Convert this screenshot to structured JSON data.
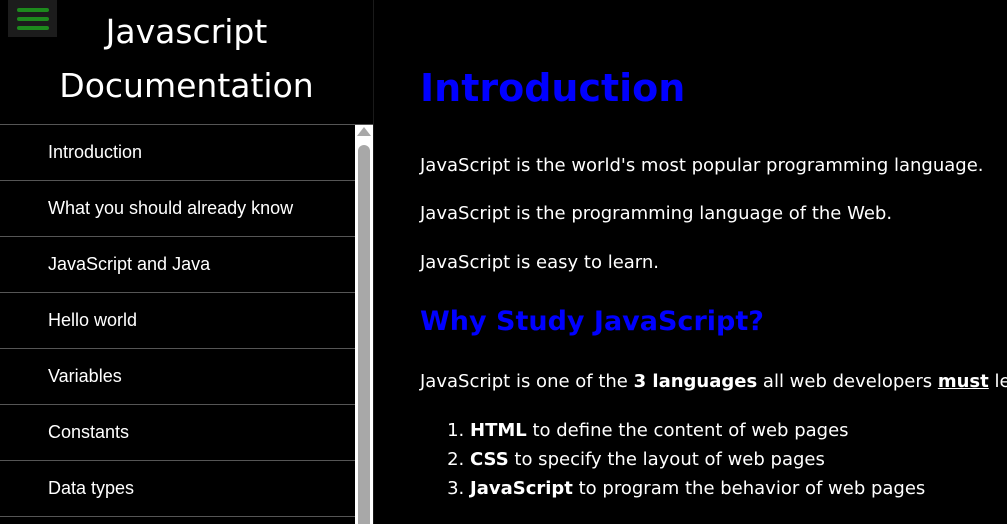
{
  "sidebar": {
    "menu_icon": "hamburger-menu-icon",
    "title_line1": "Javascript",
    "title_line2": "Documentation",
    "items": [
      {
        "label": "Introduction"
      },
      {
        "label": "What you should already know"
      },
      {
        "label": "JavaScript and Java"
      },
      {
        "label": "Hello world"
      },
      {
        "label": "Variables"
      },
      {
        "label": "Constants"
      },
      {
        "label": "Data types"
      }
    ]
  },
  "main": {
    "heading": "Introduction",
    "paragraphs": [
      "JavaScript is the world's most popular programming language.",
      "JavaScript is the programming language of the Web.",
      "JavaScript is easy to learn."
    ],
    "subheading": "Why Study JavaScript?",
    "why_text": {
      "part1": "JavaScript is one of the ",
      "bold": "3 languages",
      "part2": " all web developers ",
      "underlined": "must",
      "part3": " learn:"
    },
    "list": [
      {
        "term": "HTML",
        "desc": " to define the content of web pages"
      },
      {
        "term": "CSS",
        "desc": " to specify the layout of web pages"
      },
      {
        "term": "JavaScript",
        "desc": " to program the behavior of web pages"
      }
    ]
  },
  "colors": {
    "accent_blue": "#0000ff",
    "menu_green": "#1d8a1d",
    "background": "#000000"
  }
}
